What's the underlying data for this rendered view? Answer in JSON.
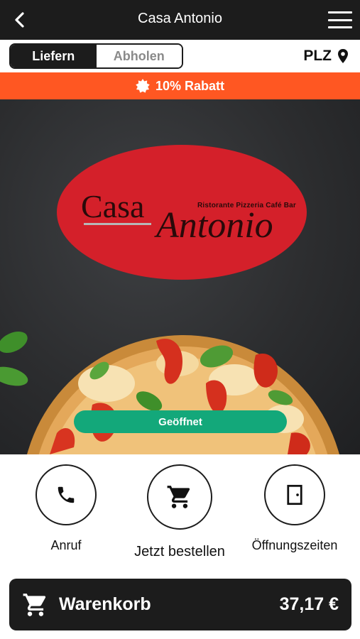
{
  "header": {
    "title": "Casa Antonio",
    "back_icon": "chevron-left-icon",
    "menu_icon": "hamburger-menu-icon"
  },
  "mode": {
    "options": [
      {
        "label": "Liefern",
        "active": true
      },
      {
        "label": "Abholen",
        "active": false
      }
    ]
  },
  "postcode": {
    "label": "PLZ",
    "icon": "location-pin-icon"
  },
  "promo": {
    "icon": "badge-icon",
    "text": "10% Rabatt",
    "color": "#ff5722"
  },
  "logo": {
    "word1": "Casa",
    "word2": "Antonio",
    "tagline": "Ristorante Pizzeria Café Bar",
    "color": "#d4202a"
  },
  "status": {
    "label": "Geöffnet",
    "color": "#13a87a"
  },
  "actions": [
    {
      "label": "Anruf",
      "icon": "phone-icon"
    },
    {
      "label": "Jetzt bestellen",
      "icon": "shopping-cart-icon"
    },
    {
      "label": "Öffnungszeiten",
      "icon": "door-icon"
    }
  ],
  "cart": {
    "label": "Warenkorb",
    "total": "37,17 €",
    "icon": "shopping-cart-icon"
  }
}
